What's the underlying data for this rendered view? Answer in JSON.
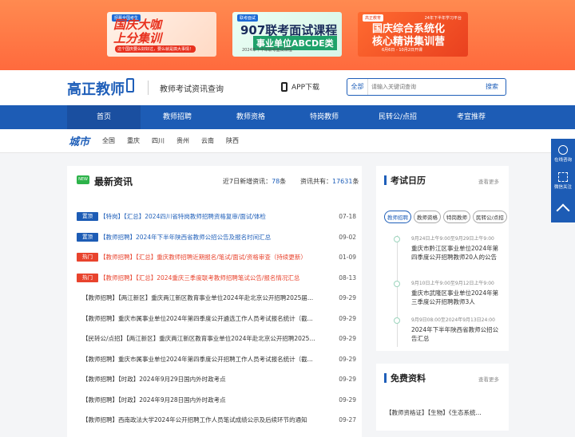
{
  "ads": [
    {
      "tag": "招募全国考生",
      "line1": "国庆大咖",
      "line2": "上分集训",
      "sub": "这个国庆要么好好过，要么就是搞大事情！"
    },
    {
      "tag": "联考面试",
      "line1": "907联考面试课程",
      "line2": "事业单位ABCDE类",
      "sub": "2024年下半年联考面试课程"
    },
    {
      "tag": "高正教育",
      "tag2": "24年下半年学习平台",
      "line1": "国庆综合系统化",
      "line2": "核心精讲集训营",
      "date": "6月6日 - 10月2日开课"
    }
  ],
  "header": {
    "logo": "高正教师",
    "slogan": "教师考试资讯查询",
    "app": "APP下载",
    "search_scope": "全部",
    "search_placeholder": "请输入关键词查询",
    "search_btn": "搜索"
  },
  "nav": [
    "首页",
    "教师招聘",
    "教师资格",
    "特岗教师",
    "民转公/点招",
    "考宣推荐"
  ],
  "city": {
    "label": "城市",
    "items": [
      "全国",
      "重庆",
      "四川",
      "贵州",
      "云南",
      "陕西"
    ]
  },
  "news": {
    "title": "最新资讯",
    "badge": "NEW",
    "stat1_label": "近7日新增资讯：",
    "stat1_num": "78",
    "stat1_unit": "条",
    "stat2_label": "资讯共有：",
    "stat2_num": "17631",
    "stat2_unit": "条",
    "rows": [
      {
        "badge": "置顶",
        "badgeColor": "#1d5cb5",
        "text": "【特岗】【汇总】2024四川省特岗教师招聘资格复审/面试/体检",
        "date": "07-18",
        "color": "#1f5fb9"
      },
      {
        "badge": "置顶",
        "badgeColor": "#1d5cb5",
        "text": "【教师招聘】2024年下半年陕西省教师公招公告及报名时间汇总",
        "date": "09-02",
        "color": "#1f5fb9"
      },
      {
        "badge": "热门",
        "badgeColor": "#e8432d",
        "text": "【教师招聘】【汇总】重庆教师招聘近期报名/笔试/面试/资格审查（持续更新）",
        "date": "01-09",
        "color": "#e8432d"
      },
      {
        "badge": "热门",
        "badgeColor": "#e8432d",
        "text": "【教师招聘】【汇总】2024重庆三季度联考教师招聘笔试公告/报名情况汇总",
        "date": "08-13",
        "color": "#e8432d"
      },
      {
        "badge": "",
        "text": "【教师招聘】【两江新区】重庆两江新区教育事业单位2024年赴北京公开招聘2025届...",
        "date": "09-29"
      },
      {
        "badge": "",
        "text": "【教师招聘】重庆市属事业单位2024年第四季度公开遴选工作人员考试报名统计（截...",
        "date": "09-29"
      },
      {
        "badge": "",
        "text": "【民转公/点招】【两江新区】重庆两江新区教育事业单位2024年赴北京公开招聘2025...",
        "date": "09-29"
      },
      {
        "badge": "",
        "text": "【教师招聘】重庆市属事业单位2024年第四季度公开招聘工作人员考试报名统计（截...",
        "date": "09-29"
      },
      {
        "badge": "",
        "text": "【教师招聘】【时政】2024年9月29日国内外时政考点",
        "date": "09-29"
      },
      {
        "badge": "",
        "text": "【教师招聘】【时政】2024年9月28日国内外时政考点",
        "date": "09-29"
      },
      {
        "badge": "",
        "text": "【教师招聘】西南政法大学2024年公开招聘工作人员笔试成绩公示及后续环节的通知",
        "date": "09-27"
      }
    ]
  },
  "calendar": {
    "title": "考试日历",
    "more": "查看更多",
    "filters": [
      "教师招聘",
      "教师资格",
      "特岗教师",
      "民转公/点招"
    ],
    "events": [
      {
        "time": "9月24日上午9:00至9月29日上午9:00",
        "desc": "重庆市黔江区事业单位2024年第四季度公开招聘教师20人的公告"
      },
      {
        "time": "9月10日上午9:00至9月12日上午9:00",
        "desc": "重庆市武隆区事业单位2024年第三季度公开招聘教师3人"
      },
      {
        "time": "9月9日08:00至2024年9月13日24:00",
        "desc": "2024年下半年陕西省教师公招公告汇总"
      }
    ]
  },
  "free": {
    "title": "免费资料",
    "more": "查看更多",
    "link": "【教师资格证】【生物】《生态系统..."
  },
  "sidebar": {
    "online": "在线咨询",
    "wechat": "微信关注"
  }
}
